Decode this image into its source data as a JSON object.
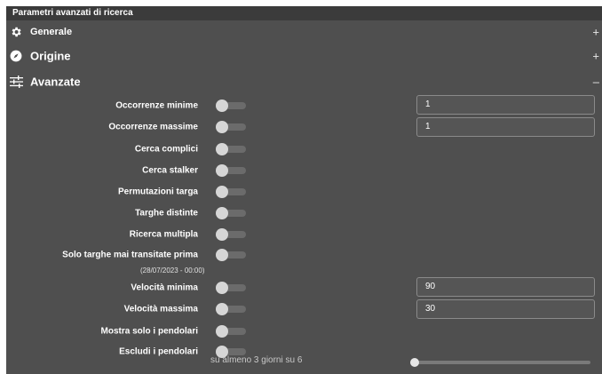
{
  "panel": {
    "title": "Parametri avanzati di ricerca"
  },
  "sections": [
    {
      "id": "generale",
      "label": "Generale",
      "icon": "gear-icon",
      "sign": "+"
    },
    {
      "id": "origine",
      "label": "Origine",
      "icon": "compass-icon",
      "sign": "+"
    },
    {
      "id": "avanzate",
      "label": "Avanzate",
      "icon": "sliders-icon",
      "sign": "–"
    }
  ],
  "advanced": {
    "occorrenze_minime": {
      "label": "Occorrenze minime",
      "value": "1",
      "enabled": false
    },
    "occorrenze_massime": {
      "label": "Occorrenze massime",
      "value": "1",
      "enabled": false
    },
    "cerca_complici": {
      "label": "Cerca complici",
      "enabled": false
    },
    "cerca_stalker": {
      "label": "Cerca stalker",
      "enabled": false
    },
    "permutazioni_targa": {
      "label": "Permutazioni targa",
      "enabled": false
    },
    "targhe_distinte": {
      "label": "Targhe distinte",
      "enabled": false
    },
    "ricerca_multipla": {
      "label": "Ricerca multipla",
      "enabled": false
    },
    "solo_targhe": {
      "label": "Solo targhe mai transitate prima",
      "sublabel": "(28/07/2023 - 00:00)",
      "enabled": false
    },
    "velocita_minima": {
      "label": "Velocità minima",
      "value": "90",
      "enabled": false
    },
    "velocita_massima": {
      "label": "Velocità massima",
      "value": "30",
      "enabled": false
    },
    "mostra_pendolari": {
      "label": "Mostra solo i pendolari",
      "enabled": false
    },
    "escludi_pendolari": {
      "label": "Escludi i pendolari",
      "enabled": false,
      "footer": "su almeno 3 giorni su 6",
      "slider_value": 0
    }
  }
}
